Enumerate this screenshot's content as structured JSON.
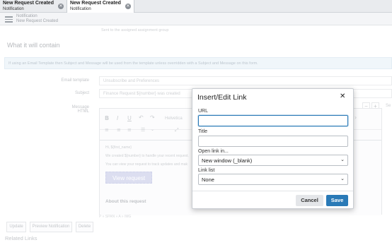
{
  "tabs": [
    {
      "title": "New Request Created",
      "subtitle": "Notification",
      "active": false
    },
    {
      "title": "New Request Created",
      "subtitle": "Notification",
      "active": true
    }
  ],
  "header": {
    "breadcrumb": "Notification",
    "title": "New Request Created"
  },
  "form": {
    "faded_line": "Sent to the assigned assignment group",
    "section_title": "What it will contain",
    "info_text": "If using an Email Template then Subject and Message will be used from the template unless overridden with a Subject and Message on this form.",
    "email_template_label": "Email template",
    "email_template_value": "Unsubscribe and Preferences",
    "subject_label": "Subject",
    "subject_value": "Finance Request ${number} was created",
    "message_label": "Message HTML",
    "editor": {
      "font_label": "Helvetica",
      "line1": "Hi, ${first_name}",
      "line2": "We created ${number} to handle your recent request.",
      "line3": "You can view your request to track updates and mak",
      "button": "View request",
      "about": "About this request",
      "footer": "P » SPAN » A » IMG"
    },
    "zoom_minus": "−",
    "zoom_plus": "+",
    "zoom_s": "Se",
    "buttons": {
      "update": "Update",
      "preview": "Preview Notification",
      "delete": "Delete"
    },
    "related_links": "Related Links"
  },
  "modal": {
    "title": "Insert/Edit Link",
    "url_label": "URL",
    "url_value": "",
    "title_label": "Title",
    "title_value": "",
    "open_label": "Open link in...",
    "open_value": "New window (_blank)",
    "list_label": "Link list",
    "list_value": "None",
    "cancel": "Cancel",
    "save": "Save"
  },
  "colors": {
    "primary": "#2a7ab7",
    "tab_bg": "#e9ebee"
  }
}
